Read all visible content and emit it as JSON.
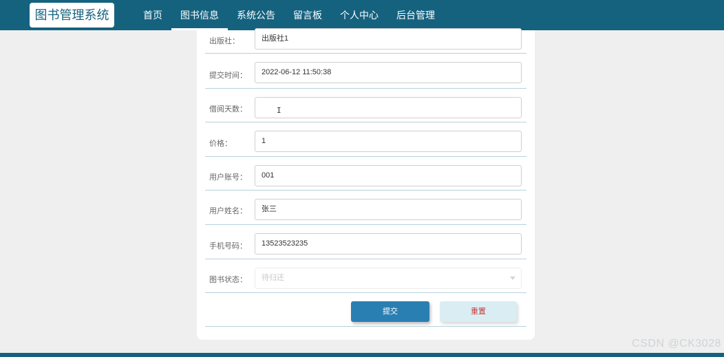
{
  "header": {
    "logo": "图书管理系统",
    "nav": [
      "首页",
      "图书信息",
      "系统公告",
      "留言板",
      "个人中心",
      "后台管理"
    ],
    "active_index": 1
  },
  "form": {
    "fields": [
      {
        "label": "出版社：",
        "value": "出版社1"
      },
      {
        "label": "提交时间：",
        "value": "2022-06-12 11:50:38"
      },
      {
        "label": "借阅天数：",
        "value": ""
      },
      {
        "label": "价格：",
        "value": "1"
      },
      {
        "label": "用户账号：",
        "value": "001"
      },
      {
        "label": "用户姓名：",
        "value": "张三"
      },
      {
        "label": "手机号码：",
        "value": "13523523235"
      },
      {
        "label": "图书状态：",
        "value": "待归还"
      }
    ],
    "submit_label": "提交",
    "reset_label": "重置"
  },
  "watermark": "CSDN @CK3028",
  "colors": {
    "primary": "#15627f",
    "submit_button": "#2a7fb2",
    "reset_button": "#d9edf2",
    "reset_text": "#c93c3c"
  }
}
